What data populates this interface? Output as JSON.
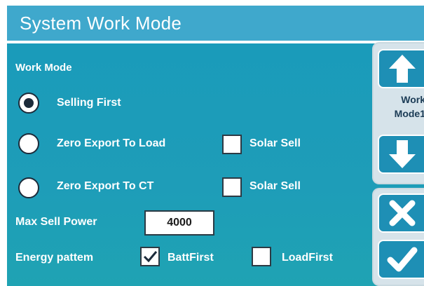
{
  "title": "System Work Mode",
  "work_mode_heading": "Work Mode",
  "modes": [
    {
      "label": "Selling First",
      "selected": true
    },
    {
      "label": "Zero Export To Load",
      "selected": false
    },
    {
      "label": "Zero Export To CT",
      "selected": false
    }
  ],
  "solar_sell": [
    {
      "label": "Solar Sell",
      "checked": false
    },
    {
      "label": "Solar Sell",
      "checked": false
    }
  ],
  "max_sell_power": {
    "label": "Max Sell Power",
    "value": "4000"
  },
  "energy_pattern": {
    "label": "Energy pattem",
    "options": [
      {
        "label": "BattFirst",
        "checked": true
      },
      {
        "label": "LoadFirst",
        "checked": false
      }
    ]
  },
  "side_panel": {
    "page_label_line1": "Work",
    "page_label_line2": "Mode1",
    "icons": [
      "arrow-up-icon",
      "arrow-down-icon",
      "close-icon",
      "check-icon"
    ]
  },
  "colors": {
    "title_bar": "#3fa8cc",
    "panel": "#1a9bba",
    "side_button": "#1e8fb5",
    "radio_fill": "#1c2b3a"
  }
}
